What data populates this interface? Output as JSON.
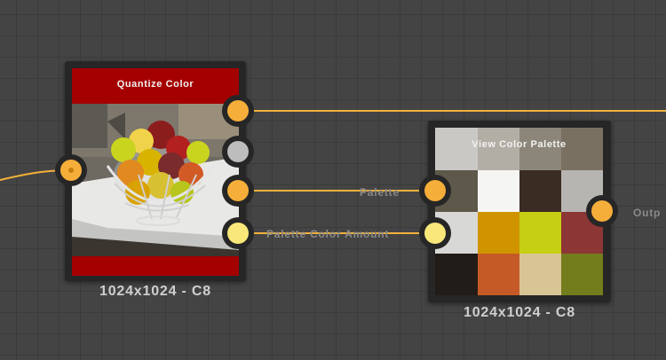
{
  "colors": {
    "wire": "#f2b23a",
    "port_orange": "#f6ae3a",
    "port_yellow": "#f9e77a",
    "port_gray": "#bdbdbd",
    "node_red": "#a50000"
  },
  "quantize_node": {
    "title": "Quantize Color",
    "size_label": "1024x1024 - C8",
    "input_port": "input-port",
    "output_ports": [
      "output-port-1",
      "output-port-2",
      "palette-output-port",
      "palette-color-amount-port"
    ]
  },
  "palette_node": {
    "title": "View Color Palette",
    "size_label": "1024x1024 - C8",
    "input_labels": [
      "Palette",
      "Palette Color Amount"
    ],
    "output_label": "Outp",
    "swatches": [
      "#c9c8c4",
      "#b3aea5",
      "#8b8679",
      "#7a7062",
      "#5e584b",
      "#f5f5f3",
      "#3a2c22",
      "#b7b5b1",
      "#d8d8d6",
      "#cf9400",
      "#c6cf14",
      "#8d3636",
      "#221c18",
      "#c65a26",
      "#d8c494",
      "#737d1c"
    ]
  }
}
